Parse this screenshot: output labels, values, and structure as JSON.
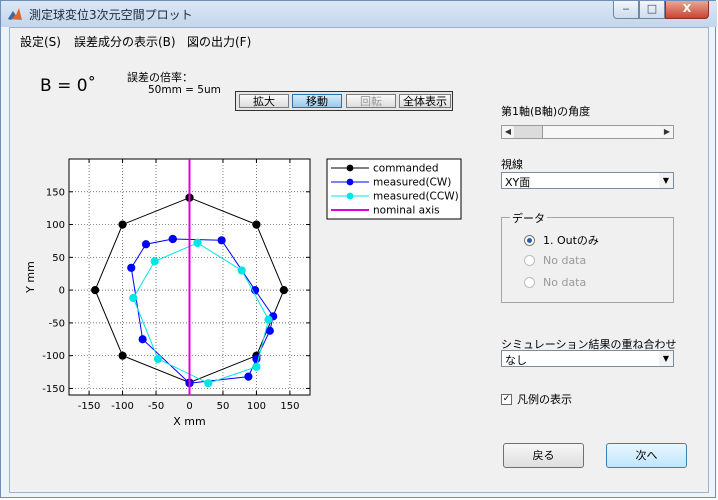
{
  "window": {
    "title": "測定球変位3次元空間プロット",
    "minimize_glyph": "‒",
    "maximize_glyph": "□",
    "close_glyph": "X"
  },
  "menu": [
    "設定(S)",
    "誤差成分の表示(B)",
    "図の出力(F)"
  ],
  "angle_readout": "B = 0˚",
  "magnification": {
    "label": "誤差の倍率：",
    "value": "50mm = 5um"
  },
  "toolbar": {
    "buttons": [
      {
        "label": "拡大",
        "state": "normal"
      },
      {
        "label": "移動",
        "state": "active"
      },
      {
        "label": "回転",
        "state": "disabled"
      },
      {
        "label": "全体表示",
        "state": "normal"
      }
    ]
  },
  "chart_data": {
    "type": "line",
    "xlabel": "X  mm",
    "ylabel": "Y  mm",
    "xlim": [
      -180,
      180
    ],
    "ylim": [
      -160,
      200
    ],
    "xticks": [
      -150,
      -100,
      -50,
      0,
      50,
      100,
      150
    ],
    "yticks": [
      -150,
      -100,
      -50,
      0,
      50,
      100,
      150
    ],
    "grid": true,
    "legend_position": "top-right",
    "series": [
      {
        "name": "commanded",
        "color": "#000000",
        "x": [
          0,
          100,
          141,
          100,
          0,
          -100,
          -141,
          -100,
          0
        ],
        "y": [
          141,
          100,
          0,
          -100,
          -141,
          -100,
          0,
          100,
          141
        ]
      },
      {
        "name": "measured(CW)",
        "color": "#0000ff",
        "x": [
          -25,
          48,
          98,
          125,
          120,
          100,
          88,
          0,
          -70,
          -87,
          -65,
          -25
        ],
        "y": [
          78,
          76,
          0,
          -40,
          -62,
          -105,
          -132,
          -142,
          -75,
          34,
          70,
          78
        ]
      },
      {
        "name": "measured(CCW)",
        "color": "#00e5e5",
        "x": [
          12,
          78,
          118,
          100,
          28,
          -47,
          -84,
          -52,
          12
        ],
        "y": [
          72,
          30,
          -45,
          -117,
          -142,
          -105,
          -12,
          44,
          72
        ]
      },
      {
        "name": "nominal axis",
        "color": "#dd00dd",
        "x": [
          0,
          0
        ],
        "y": [
          -160,
          200
        ]
      }
    ]
  },
  "axis1_angle": {
    "label": "第1軸(B軸)の角度"
  },
  "view": {
    "label": "視線",
    "value": "XY面"
  },
  "data_group": {
    "title": "データ",
    "items": [
      {
        "label": "1. Outのみ",
        "selected": true,
        "enabled": true
      },
      {
        "label": "No data",
        "selected": false,
        "enabled": false
      },
      {
        "label": "No data",
        "selected": false,
        "enabled": false
      }
    ]
  },
  "simulation": {
    "label": "シミュレーション結果の重ね合わせ",
    "value": "なし"
  },
  "legend_toggle": {
    "label": "凡例の表示",
    "checked": true,
    "check_glyph": "✓"
  },
  "buttons": {
    "back": "戻る",
    "next": "次へ"
  },
  "glyphs": {
    "arrow_left": "◀",
    "arrow_right": "▶",
    "dropdown": "▼"
  }
}
